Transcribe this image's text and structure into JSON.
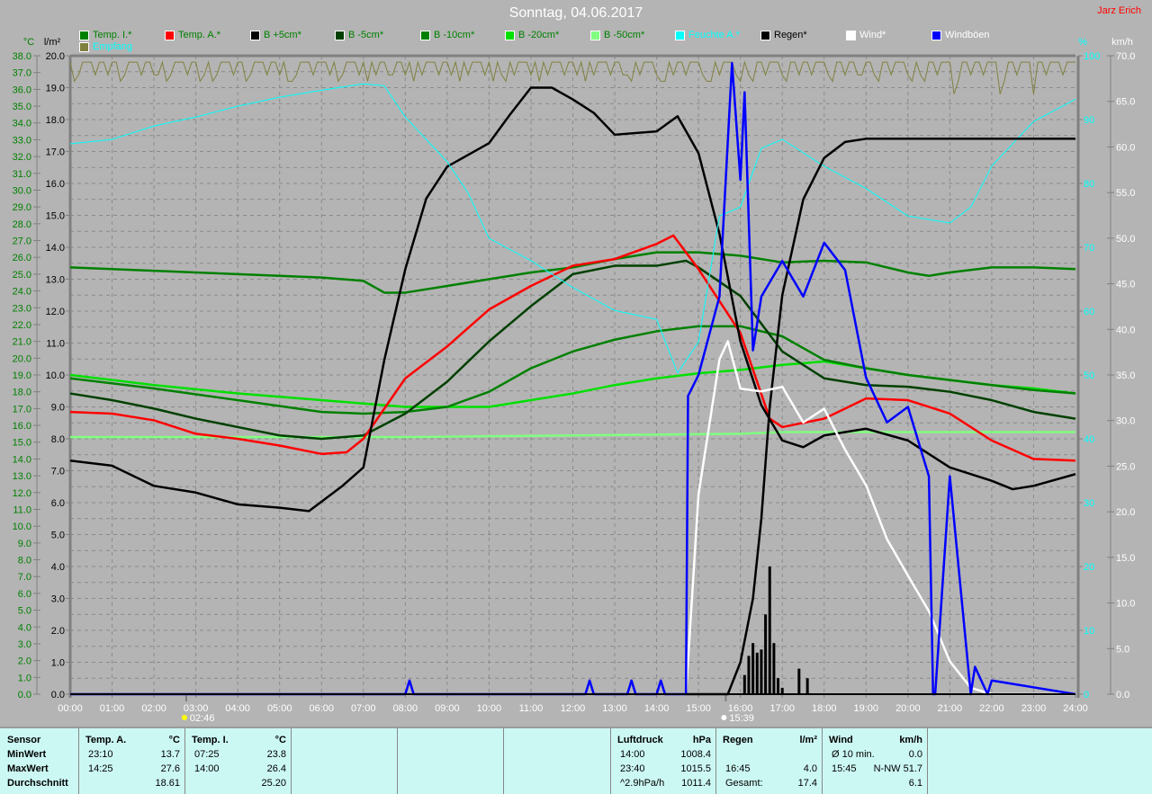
{
  "header": {
    "title": "Sonntag, 04.06.2017",
    "author": "Jarz Erich"
  },
  "legend": [
    {
      "label": "Temp. I.*",
      "color": "#008000",
      "text_color": "#008000"
    },
    {
      "label": "Temp. A.*",
      "color": "#ff0000",
      "text_color": "#008000"
    },
    {
      "label": "B +5cm*",
      "color": "#000000",
      "text_color": "#008000"
    },
    {
      "label": "B -5cm*",
      "color": "#004000",
      "text_color": "#008000"
    },
    {
      "label": "B -10cm*",
      "color": "#008000",
      "text_color": "#008000"
    },
    {
      "label": "B -20cm*",
      "color": "#00e000",
      "text_color": "#008000"
    },
    {
      "label": "B -50cm*",
      "color": "#80ff80",
      "text_color": "#008000"
    },
    {
      "label": "Feuchte A.*",
      "color": "#00ffff",
      "text_color": "#00ffff"
    },
    {
      "label": "Regen*",
      "color": "#000000",
      "text_color": "#000000"
    },
    {
      "label": "Wind*",
      "color": "#ffffff",
      "text_color": "#ffffff"
    },
    {
      "label": "Windböen",
      "color": "#0000ff",
      "text_color": "#ffffff"
    },
    {
      "label": "Empfang",
      "color": "#808040",
      "text_color": "#00ffff"
    }
  ],
  "chart_data": {
    "type": "line",
    "title": "Sonntag, 04.06.2017",
    "axes": {
      "temp": {
        "label": "°C",
        "range": [
          0,
          38
        ],
        "step": 1,
        "color": "#008000"
      },
      "rain": {
        "label": "l/m²",
        "range": [
          0,
          20
        ],
        "step": 1,
        "color": "#000000"
      },
      "humidity": {
        "label": "%",
        "range": [
          0,
          100
        ],
        "step": 10,
        "color": "#00ffff"
      },
      "wind": {
        "label": "km/h",
        "range": [
          0,
          70
        ],
        "step": 5,
        "color": "#ffffff"
      },
      "x": {
        "range": [
          0,
          24
        ],
        "ticks": [
          "00:00",
          "01:00",
          "02:00",
          "03:00",
          "04:00",
          "05:00",
          "06:00",
          "07:00",
          "08:00",
          "09:00",
          "10:00",
          "11:00",
          "12:00",
          "13:00",
          "14:00",
          "15:00",
          "16:00",
          "17:00",
          "18:00",
          "19:00",
          "20:00",
          "21:00",
          "22:00",
          "23:00",
          "24:00"
        ]
      }
    },
    "markers": [
      {
        "label": "02:46",
        "hour": 2.77,
        "icon": "sunrise-icon"
      },
      {
        "label": "15:39",
        "hour": 15.65,
        "icon": "moon-icon"
      }
    ],
    "grid": true,
    "series": [
      {
        "name": "Temp. I.*",
        "axis": "temp",
        "color": "#008000",
        "x": [
          0,
          2,
          4,
          6,
          7,
          7.5,
          8,
          9,
          10,
          11,
          12,
          13,
          14,
          15,
          16,
          17,
          18,
          19,
          20,
          20.5,
          21,
          22,
          23,
          24
        ],
        "y": [
          25.4,
          25.2,
          25.0,
          24.8,
          24.6,
          23.9,
          23.9,
          24.3,
          24.7,
          25.1,
          25.4,
          25.9,
          26.3,
          26.3,
          26.1,
          25.7,
          25.8,
          25.7,
          25.1,
          24.9,
          25.1,
          25.4,
          25.4,
          25.3
        ]
      },
      {
        "name": "B -50cm*",
        "axis": "temp",
        "color": "#80ff80",
        "x": [
          0,
          8,
          12,
          16,
          17,
          24
        ],
        "y": [
          15.3,
          15.3,
          15.4,
          15.5,
          15.6,
          15.6
        ]
      },
      {
        "name": "B -20cm*",
        "axis": "temp",
        "color": "#00e000",
        "x": [
          0,
          2,
          4,
          6,
          7,
          8,
          9,
          10,
          11,
          12,
          13,
          14,
          15,
          16,
          17,
          18,
          19,
          20,
          21,
          22,
          23,
          24
        ],
        "y": [
          19.0,
          18.4,
          17.9,
          17.5,
          17.3,
          17.1,
          17.1,
          17.1,
          17.5,
          17.9,
          18.4,
          18.8,
          19.1,
          19.3,
          19.6,
          19.8,
          19.4,
          19.0,
          18.7,
          18.4,
          18.2,
          17.9
        ]
      },
      {
        "name": "B -10cm*",
        "axis": "temp",
        "color": "#008000",
        "x": [
          0,
          2,
          4,
          6,
          7,
          8,
          9,
          10,
          11,
          12,
          13,
          14,
          15,
          16,
          17,
          18,
          19,
          20,
          21,
          22,
          23,
          24
        ],
        "y": [
          18.8,
          18.2,
          17.5,
          16.8,
          16.7,
          16.8,
          17.1,
          18.0,
          19.4,
          20.4,
          21.1,
          21.6,
          21.9,
          21.9,
          21.3,
          19.9,
          19.4,
          19.0,
          18.7,
          18.4,
          18.1,
          17.9
        ]
      },
      {
        "name": "B -5cm*",
        "axis": "temp",
        "color": "#004000",
        "x": [
          0,
          1,
          2,
          3,
          4,
          5,
          6,
          7,
          8,
          9,
          10,
          11,
          12,
          13,
          14,
          14.7,
          15,
          16,
          17,
          18,
          19,
          20,
          21,
          22,
          23,
          24
        ],
        "y": [
          17.9,
          17.5,
          17.0,
          16.4,
          15.9,
          15.4,
          15.2,
          15.4,
          16.7,
          18.6,
          21.0,
          23.1,
          25.0,
          25.5,
          25.5,
          25.8,
          25.4,
          23.7,
          20.4,
          18.8,
          18.4,
          18.3,
          18.0,
          17.5,
          16.8,
          16.4
        ]
      },
      {
        "name": "Temp. A.*",
        "axis": "temp",
        "color": "#ff0000",
        "x": [
          0,
          1,
          2,
          3,
          4,
          5,
          6,
          6.6,
          7,
          7.5,
          8,
          9,
          10,
          11,
          12,
          13,
          14,
          14.4,
          15,
          16,
          16.7,
          17,
          18,
          19,
          20,
          21,
          22,
          23,
          24
        ],
        "y": [
          16.8,
          16.7,
          16.3,
          15.5,
          15.2,
          14.8,
          14.3,
          14.4,
          15.2,
          17.0,
          18.8,
          20.7,
          22.9,
          24.3,
          25.5,
          25.9,
          26.8,
          27.3,
          25.3,
          21.5,
          16.4,
          15.9,
          16.4,
          17.6,
          17.5,
          16.7,
          15.1,
          14.0,
          13.9
        ]
      },
      {
        "name": "B +5cm*",
        "axis": "temp",
        "color": "#000000",
        "x": [
          0,
          1,
          2,
          3,
          4,
          5,
          5.7,
          6.5,
          7,
          7.5,
          8,
          8.5,
          9,
          10,
          10.5,
          11,
          11.5,
          12,
          12.5,
          13,
          14,
          14.5,
          15,
          15.5,
          16,
          16.5,
          17,
          17.5,
          18,
          18.5,
          19,
          20,
          21,
          22,
          22.5,
          23,
          24
        ],
        "y": [
          13.9,
          13.6,
          12.4,
          12.0,
          11.3,
          11.1,
          10.9,
          12.4,
          13.5,
          19.9,
          25.3,
          29.5,
          31.4,
          32.8,
          34.5,
          36.1,
          36.1,
          35.4,
          34.6,
          33.3,
          33.5,
          34.4,
          32.2,
          27.4,
          21.0,
          17.2,
          15.1,
          14.7,
          15.4,
          15.6,
          15.8,
          15.1,
          13.5,
          12.7,
          12.2,
          12.4,
          13.1
        ]
      },
      {
        "name": "Feuchte A.*",
        "axis": "humidity",
        "color": "#00ffff",
        "x": [
          0,
          1,
          2,
          3,
          4,
          5,
          6,
          7,
          7.5,
          8,
          9,
          9.5,
          10,
          11,
          12,
          13,
          14,
          14.5,
          15,
          15.5,
          16,
          16.5,
          17,
          18,
          19,
          20,
          21,
          21.5,
          22,
          23,
          24
        ],
        "y": [
          86.2,
          86.9,
          89.0,
          90.4,
          92.1,
          93.5,
          94.6,
          95.6,
          95.3,
          90.4,
          83.4,
          78.5,
          71.4,
          67.9,
          63.7,
          60.1,
          58.7,
          50.3,
          55.2,
          74.9,
          76.3,
          85.5,
          86.9,
          82.7,
          79.2,
          74.9,
          73.8,
          76.3,
          82.7,
          89.7,
          93.2
        ]
      },
      {
        "name": "Regen*",
        "axis": "rain",
        "color": "#000000",
        "x": [
          0,
          15.7,
          16.0,
          16.3,
          16.5,
          16.7,
          17.0,
          17.5,
          18.0,
          18.5,
          19,
          24
        ],
        "y": [
          0,
          0,
          1.0,
          3.0,
          5.5,
          9.0,
          12.5,
          15.5,
          16.8,
          17.3,
          17.4,
          17.4
        ]
      },
      {
        "name": "Wind*",
        "axis": "wind",
        "color": "#ffffff",
        "x": [
          0,
          14.7,
          15,
          15.5,
          15.7,
          16,
          16.5,
          17,
          17.5,
          18,
          18.5,
          19,
          19.5,
          20,
          20.5,
          21,
          21.5,
          22,
          24
        ],
        "y": [
          0,
          0,
          21.9,
          36.7,
          38.7,
          33.5,
          33.2,
          33.7,
          29.8,
          31.3,
          26.8,
          22.9,
          17.0,
          13.0,
          9.1,
          3.6,
          0.7,
          0,
          0
        ]
      },
      {
        "name": "Windböen",
        "axis": "wind",
        "color": "#0000ff",
        "x": [
          0,
          8.0,
          8.1,
          8.2,
          12.3,
          12.4,
          12.5,
          13.3,
          13.4,
          13.5,
          14.0,
          14.1,
          14.2,
          14.6,
          14.7,
          14.75,
          15,
          15.5,
          15.8,
          16,
          16.1,
          16.3,
          16.5,
          17,
          17.5,
          18,
          18.5,
          19,
          19.5,
          20,
          20.5,
          20.6,
          20.65,
          21,
          21.5,
          21.6,
          21.9,
          22,
          24
        ],
        "y": [
          0,
          0,
          1.5,
          0,
          0,
          1.5,
          0,
          0,
          1.5,
          0,
          0,
          1.5,
          0,
          0,
          0,
          32.7,
          35.0,
          43.6,
          69.2,
          56.4,
          66.0,
          37.7,
          43.6,
          47.5,
          43.6,
          49.5,
          46.5,
          34.7,
          29.8,
          31.5,
          23.9,
          0,
          0,
          23.9,
          0,
          3.0,
          0,
          1.5,
          0
        ]
      },
      {
        "name": "Regen-Menge",
        "axis": "rain",
        "type": "bar",
        "color": "#000000",
        "x": [
          16.1,
          16.2,
          16.3,
          16.4,
          16.5,
          16.6,
          16.7,
          16.8,
          16.9,
          17.0,
          17.4,
          17.6
        ],
        "y": [
          0.6,
          1.2,
          1.6,
          1.3,
          1.4,
          2.5,
          4.0,
          1.6,
          0.5,
          0.2,
          0.8,
          0.5
        ]
      }
    ]
  },
  "table": {
    "col1": {
      "header": "Sensor",
      "rows": [
        "MinWert",
        "MaxWert",
        "Durchschnitt"
      ]
    },
    "col2": {
      "header": "Temp. A.",
      "unit": "°C",
      "rows": [
        [
          "23:10",
          "13.7"
        ],
        [
          "14:25",
          "27.6"
        ],
        [
          "",
          "18.61"
        ]
      ]
    },
    "col3": {
      "header": "Temp. I.",
      "unit": "°C",
      "rows": [
        [
          "07:25",
          "23.8"
        ],
        [
          "14:00",
          "26.4"
        ],
        [
          "",
          "25.20"
        ]
      ]
    },
    "col4": {
      "header": "Luftdruck",
      "unit": "hPa",
      "rows": [
        [
          "14:00",
          "1008.4"
        ],
        [
          "23:40",
          "1015.5"
        ],
        [
          "^2.9hPa/h",
          "1011.4"
        ]
      ]
    },
    "col5": {
      "header": "Regen",
      "unit": "l/m²",
      "rows": [
        [
          "",
          ""
        ],
        [
          "16:45",
          "4.0"
        ],
        [
          "Gesamt:",
          "17.4"
        ]
      ]
    },
    "col6": {
      "header": "Wind",
      "unit": "km/h",
      "rows": [
        [
          "Ø 10 min.",
          "0.0"
        ],
        [
          "15:45",
          "N-NW 51.7"
        ],
        [
          "",
          "6.1"
        ]
      ]
    }
  }
}
